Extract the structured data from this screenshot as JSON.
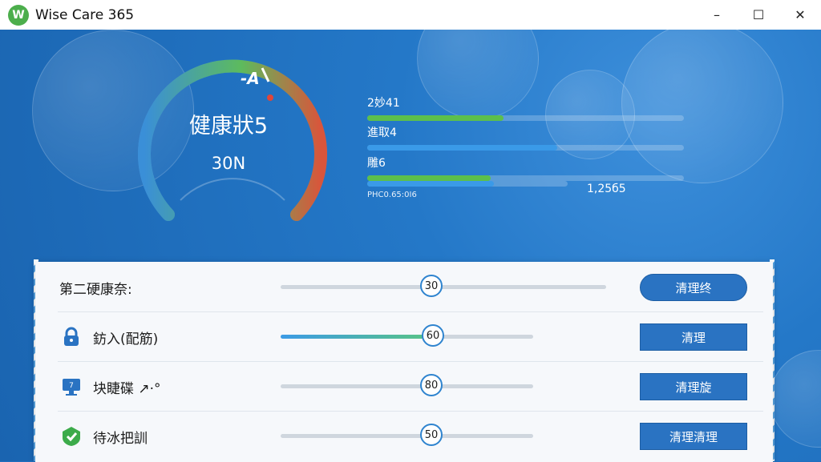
{
  "window": {
    "title": "Wise Care 365",
    "logo_letter": "W",
    "controls": {
      "minimize": "–",
      "maximize": "☐",
      "close": "✕"
    }
  },
  "gauge": {
    "label": "健康狀5",
    "value": "30N",
    "marker": "-A",
    "colors": {
      "start": "#3a8fd8",
      "mid": "#5dbb5d",
      "end": "#d9553b"
    }
  },
  "stats": [
    {
      "label": "2妙41",
      "fill_percent": 43,
      "color": "#5cbf4c"
    },
    {
      "label": "進取4",
      "fill_percent": 60,
      "color": "#3a9ae8"
    },
    {
      "label": "雕6",
      "fill_percent": 39,
      "color": "#5cbf4c"
    },
    {
      "label": "",
      "fill_percent": 63,
      "color": "#3a9ae8",
      "extra": "1,25б5"
    }
  ],
  "stat_footnote": "PHC0.65:0I6",
  "rows": [
    {
      "label": "第二硬康奈:",
      "icon": "none",
      "knob": "30",
      "fill_percent": 0,
      "button": "清理终",
      "track_end": "wide"
    },
    {
      "label": "鈁入(配筋)",
      "icon": "lock-icon",
      "knob": "60",
      "fill_percent": 100,
      "button": "清理",
      "track_end": "short"
    },
    {
      "label": "块睫碟 ↗·°",
      "icon": "monitor-icon",
      "knob": "80",
      "fill_percent": 0,
      "button": "清理旋",
      "track_end": "short"
    },
    {
      "label": "待冰把訓",
      "icon": "shield-check-icon",
      "knob": "50",
      "fill_percent": 0,
      "button": "清理清理",
      "track_end": "short"
    }
  ]
}
